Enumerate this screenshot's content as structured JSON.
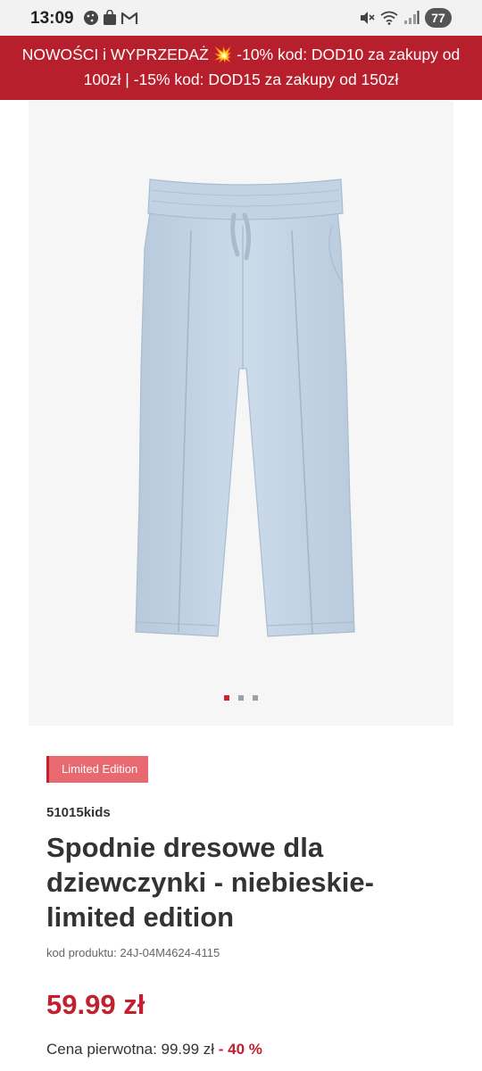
{
  "status_bar": {
    "time": "13:09",
    "battery_level": "77",
    "left_icons": [
      "cookie-icon",
      "shopping-bag-icon",
      "gmail-icon"
    ],
    "right_icons": [
      "mute-icon",
      "wifi-icon",
      "signal-icon"
    ]
  },
  "promo": {
    "text_part1": "NOWOŚCI i WYPRZEDAŻ ",
    "burst": "💥",
    "text_part2": " -10% kod: DOD10 za zakupy od 100zł | -15% kod: DOD15 za zakupy od 150zł"
  },
  "colors": {
    "brand_red": "#c1202e",
    "banner_red": "#b81f2c",
    "badge_bg": "#e86a70",
    "product_color": "#c5d6e6"
  },
  "product": {
    "image_icon": "pants-image",
    "carousel": {
      "total": 3,
      "active": 1
    },
    "badge": "Limited Edition",
    "brand": "51015kids",
    "title": "Spodnie dresowe dla dziewczynki - niebieskie- limited edition",
    "code": "kod produktu: 24J-04M4624-4115",
    "price": "59.99 zł",
    "original_price_label": "Cena pierwotna: 99.99 zł",
    "discount_sep": " - ",
    "discount": "40 %"
  }
}
